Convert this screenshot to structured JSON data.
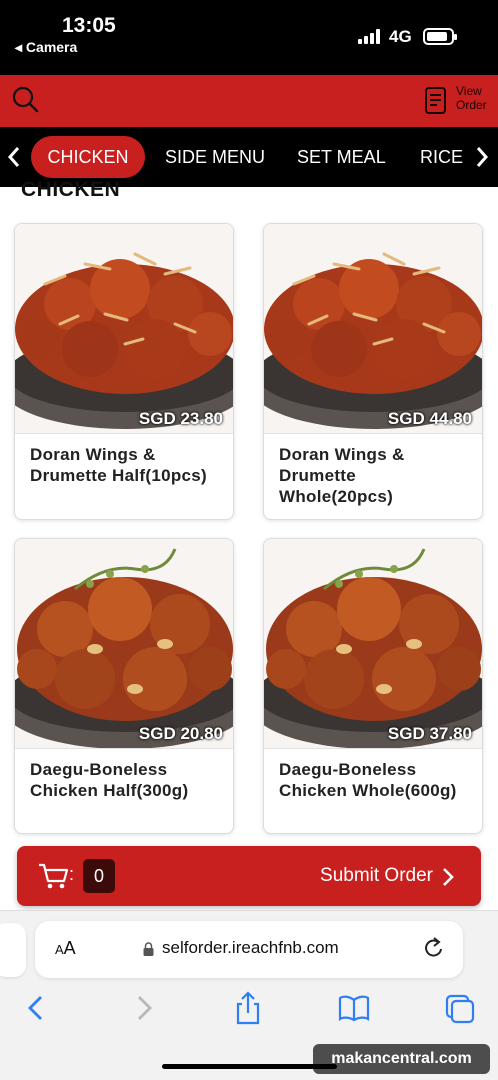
{
  "status": {
    "time": "13:05",
    "back_app": "◂ Camera",
    "network": "4G"
  },
  "header": {
    "view_order_label": "View Order"
  },
  "categories": {
    "tabs": [
      {
        "label": "CHICKEN",
        "active": true
      },
      {
        "label": "SIDE MENU",
        "active": false
      },
      {
        "label": "SET MEAL",
        "active": false
      },
      {
        "label": "RICE",
        "active": false
      }
    ]
  },
  "section": {
    "title": "CHICKEN"
  },
  "products": [
    {
      "name": "Doran Wings & Drumette Half(10pcs)",
      "price": "SGD 23.80",
      "image": "glazed-wings-photo"
    },
    {
      "name": "Doran Wings & Drumette Whole(20pcs)",
      "price": "SGD 44.80",
      "image": "glazed-wings-photo"
    },
    {
      "name": "Daegu-Boneless Chicken Half(300g)",
      "price": "SGD 20.80",
      "image": "boneless-chicken-photo"
    },
    {
      "name": "Daegu-Boneless Chicken Whole(600g)",
      "price": "SGD 37.80",
      "image": "boneless-chicken-photo"
    }
  ],
  "cart": {
    "colon": ":",
    "count": "0",
    "submit_label": "Submit Order"
  },
  "browser": {
    "aa_small": "A",
    "aa_large": "A",
    "url": "selforder.ireachfnb.com"
  },
  "watermark": "makancentral.com",
  "colors": {
    "brand_red": "#c8201f",
    "nav_black": "#000000"
  }
}
